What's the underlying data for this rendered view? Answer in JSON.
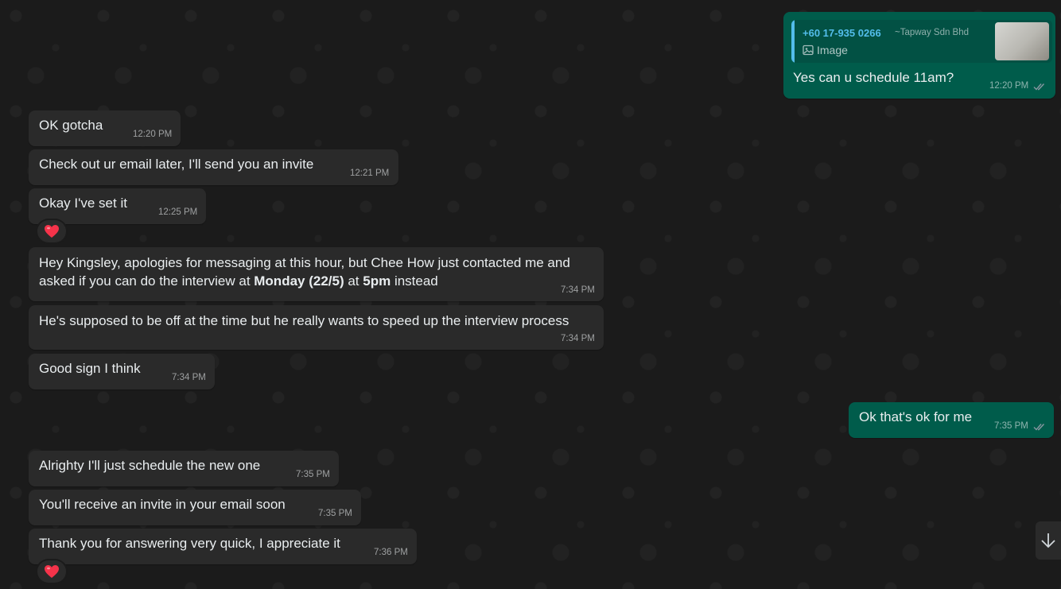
{
  "messages": [
    {
      "id": "m1",
      "direction": "out",
      "quote": {
        "author": "+60 17-935 0266",
        "push_name": "~Tapway Sdn Bhd",
        "type_label": "Image",
        "icon": "image-icon"
      },
      "text": "Yes can u schedule 11am?",
      "time": "12:20 PM",
      "status": "read"
    },
    {
      "id": "m2",
      "direction": "in",
      "text": "OK gotcha",
      "time": "12:20 PM"
    },
    {
      "id": "m3",
      "direction": "in",
      "text": "Check out ur email later, I'll send you an invite",
      "time": "12:21 PM"
    },
    {
      "id": "m4",
      "direction": "in",
      "text": "Okay I've set it",
      "time": "12:25 PM",
      "reaction": "❤️"
    },
    {
      "id": "m5",
      "direction": "in",
      "line1": "Hey Kingsley, apologies for messaging at this hour, but Chee How just contacted me and",
      "line2_prefix": "asked if you can do the interview at ",
      "line2_bold1": "Monday (22/5)",
      "line2_mid": " at ",
      "line2_bold2": "5pm",
      "line2_suffix": " instead",
      "time": "7:34 PM"
    },
    {
      "id": "m6",
      "direction": "in",
      "text": "He's supposed to be off at the time but he really wants to speed up the interview process",
      "time": "7:34 PM"
    },
    {
      "id": "m7",
      "direction": "in",
      "text": "Good sign I think",
      "time": "7:34 PM"
    },
    {
      "id": "m8",
      "direction": "out",
      "text": "Ok that's ok for me",
      "time": "7:35 PM",
      "status": "read"
    },
    {
      "id": "m9",
      "direction": "in",
      "text": "Alrighty I'll just schedule the new one",
      "time": "7:35 PM"
    },
    {
      "id": "m10",
      "direction": "in",
      "text": "You'll receive an invite in your email soon",
      "time": "7:35 PM"
    },
    {
      "id": "m11",
      "direction": "in",
      "text": "Thank you for answering very quick, I appreciate it",
      "time": "7:36 PM",
      "reaction": "❤️"
    }
  ],
  "scroll_button_icon": "arrow-down-icon",
  "colors": {
    "background": "#1b1b1b",
    "incoming_bubble": "#2a2a2a",
    "outgoing_bubble": "#005c4b",
    "quote_author": "#53bdeb",
    "read_ticks": "#8696a0"
  }
}
